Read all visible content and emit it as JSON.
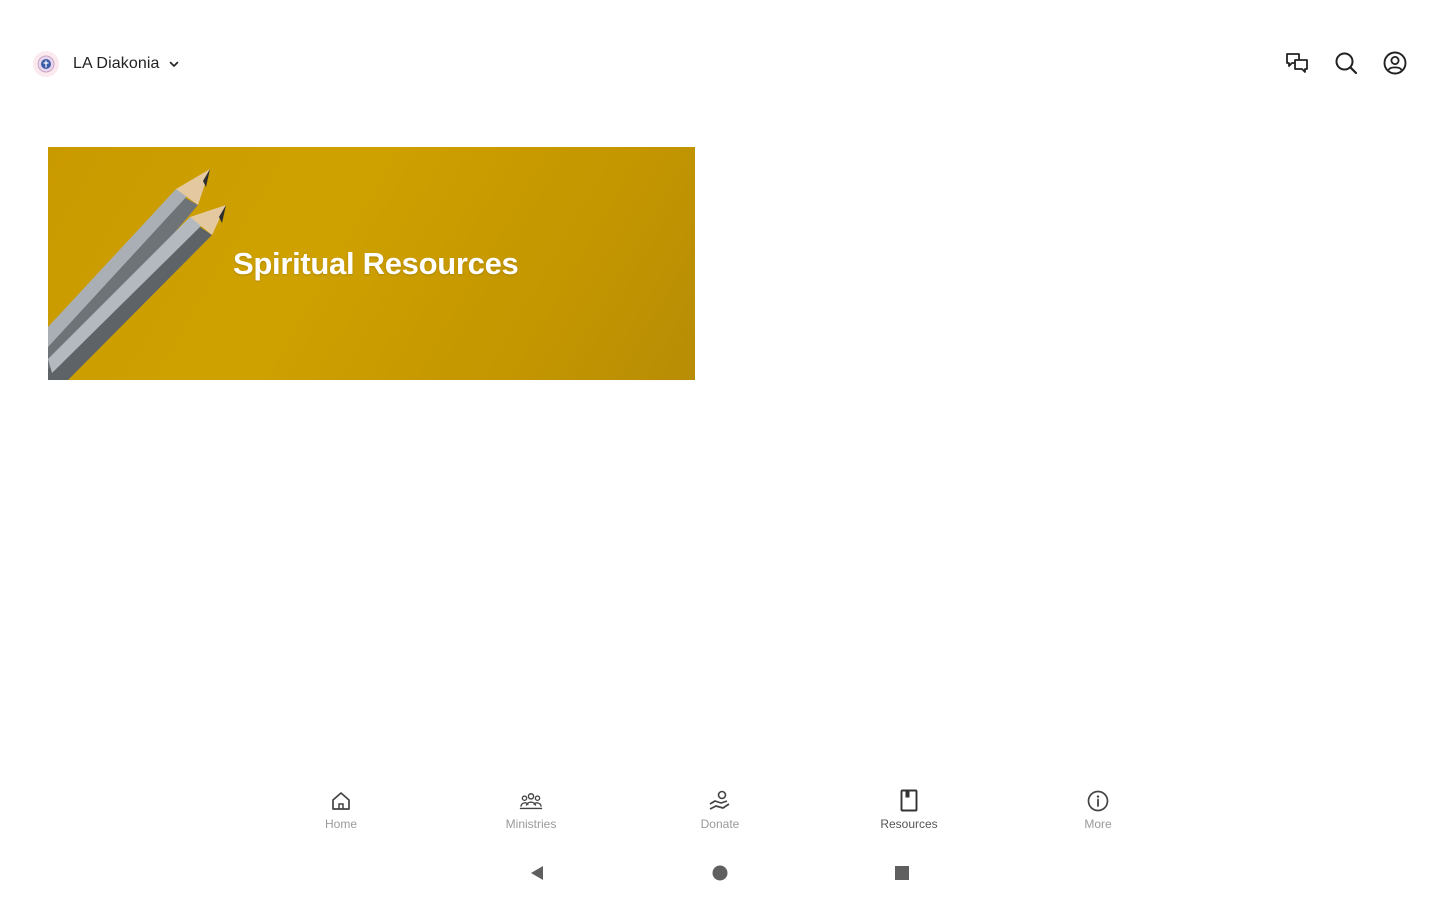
{
  "header": {
    "org_name": "LA Diakonia",
    "org_logo_icon": "church-seal-icon",
    "actions": [
      {
        "name": "messages",
        "icon": "chat-bubbles-icon"
      },
      {
        "name": "search",
        "icon": "search-icon"
      },
      {
        "name": "profile",
        "icon": "account-circle-icon"
      }
    ]
  },
  "banner": {
    "title": "Spiritual Resources",
    "background_color": "#c99a00"
  },
  "bottom_nav": {
    "items": [
      {
        "label": "Home",
        "icon": "home-icon"
      },
      {
        "label": "Ministries",
        "icon": "people-group-icon"
      },
      {
        "label": "Donate",
        "icon": "hand-giving-icon"
      },
      {
        "label": "Resources",
        "icon": "book-icon",
        "active": true
      },
      {
        "label": "More",
        "icon": "info-circle-icon"
      }
    ]
  },
  "system_nav": {
    "buttons": [
      "back-triangle-icon",
      "home-circle-icon",
      "recents-square-icon"
    ]
  },
  "colors": {
    "text_primary": "#222222",
    "nav_label": "#9a9a9a",
    "banner_gold": "#c99a00"
  }
}
